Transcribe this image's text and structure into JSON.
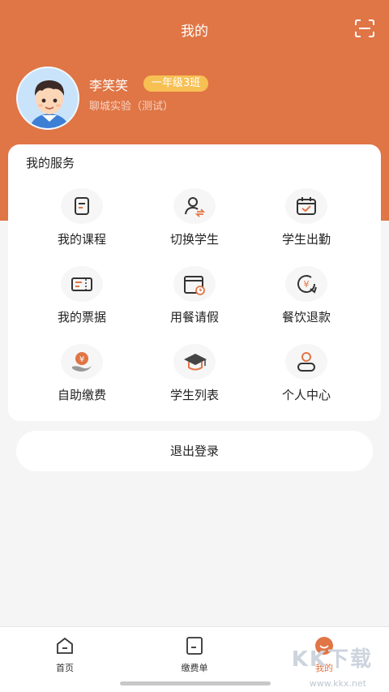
{
  "header": {
    "title": "我的"
  },
  "profile": {
    "name": "李笑笑",
    "grade": "一年级3班",
    "school": "聊城实验（测试）"
  },
  "services": {
    "title": "我的服务",
    "items": [
      {
        "label": "我的课程",
        "icon": "course-icon"
      },
      {
        "label": "切换学生",
        "icon": "switch-student-icon"
      },
      {
        "label": "学生出勤",
        "icon": "attendance-icon"
      },
      {
        "label": "我的票据",
        "icon": "receipt-icon"
      },
      {
        "label": "用餐请假",
        "icon": "meal-leave-icon"
      },
      {
        "label": "餐饮退款",
        "icon": "refund-icon"
      },
      {
        "label": "自助缴费",
        "icon": "self-payment-icon"
      },
      {
        "label": "学生列表",
        "icon": "student-list-icon"
      },
      {
        "label": "个人中心",
        "icon": "personal-center-icon"
      }
    ]
  },
  "logout_label": "退出登录",
  "tabbar": {
    "items": [
      {
        "label": "首页"
      },
      {
        "label": "缴费单"
      },
      {
        "label": "我的"
      }
    ]
  },
  "watermark": {
    "text": "KK下载",
    "url": "www.kkx.net"
  },
  "colors": {
    "accent": "#e07545",
    "badge": "#f7c053"
  }
}
